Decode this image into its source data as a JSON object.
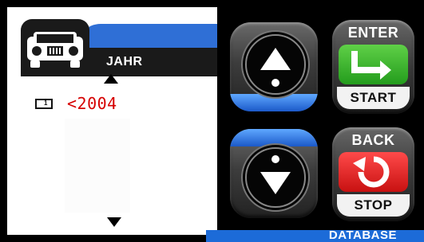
{
  "menu": {
    "label": "JAHR",
    "row_indicator": "1",
    "selected_value": "<2004"
  },
  "buttons": {
    "enter_label": "ENTER",
    "start_label": "START",
    "back_label": "BACK",
    "stop_label": "STOP"
  },
  "footer": {
    "label": "DATABASE"
  },
  "colors": {
    "accent_blue": "#2f6fd6",
    "value_red": "#d60000",
    "start_green": "#2fb526",
    "stop_red": "#e21b1b"
  },
  "icons": {
    "car": "car-front-icon",
    "up": "arrow-up-icon",
    "down": "arrow-down-icon",
    "enter": "enter-arrow-icon",
    "back": "back-arrow-icon"
  }
}
